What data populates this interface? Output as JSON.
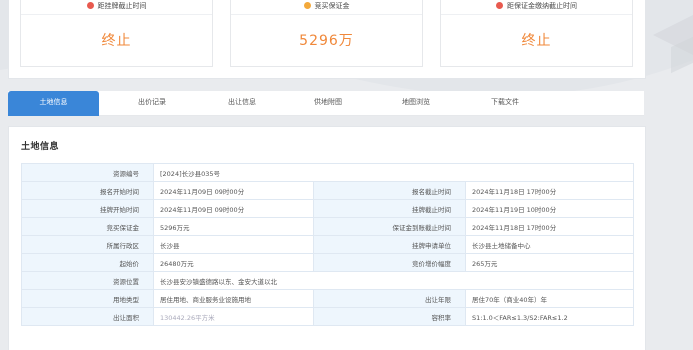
{
  "cards": [
    {
      "icon": "clock-icon",
      "icon_color": "#e85a4f",
      "label": "距挂牌截止时间",
      "value": "终止"
    },
    {
      "icon": "coin-icon",
      "icon_color": "#f3a93b",
      "label": "竞买保证金",
      "value": "5296万"
    },
    {
      "icon": "alarm-icon",
      "icon_color": "#e85a4f",
      "label": "距保证金缴纳截止时间",
      "value": "终止"
    }
  ],
  "tabs": [
    "土地信息",
    "出价记录",
    "出让信息",
    "供地附图",
    "地图浏览",
    "下载文件"
  ],
  "active_tab": "土地信息",
  "section_title": "土地信息",
  "rows": [
    {
      "full": true,
      "l1": "资源编号",
      "v1": "[2024]长沙县035号"
    },
    {
      "l1": "报名开始时间",
      "v1": "2024年11月09日 09时00分",
      "l2": "报名截止时间",
      "v2": "2024年11月18日 17时00分"
    },
    {
      "l1": "挂牌开始时间",
      "v1": "2024年11月09日 09时00分",
      "l2": "挂牌截止时间",
      "v2": "2024年11月19日 10时00分"
    },
    {
      "l1": "竞买保证金",
      "v1": "5296万元",
      "l2": "保证金到账截止时间",
      "v2": "2024年11月18日 17时00分"
    },
    {
      "l1": "所属行政区",
      "v1": "长沙县",
      "l2": "挂牌申请单位",
      "v2": "长沙县土地储备中心"
    },
    {
      "l1": "起始价",
      "v1": "26480万元",
      "l2": "竞价增价幅度",
      "v2": "265万元"
    },
    {
      "full": true,
      "l1": "资源位置",
      "v1": "长沙县安沙镇盛德路以东、金安大道以北"
    },
    {
      "l1": "用地类型",
      "v1": "居住用地、商业服务业设施用地",
      "l2": "出让年限",
      "v2": "居住70年（商业40年）年"
    },
    {
      "l1": "出让面积",
      "v1": "130442.26平方米",
      "l2": "容积率",
      "v2": "S1:1.0＜FAR≤1.3/S2:FAR≤1.2",
      "faint": true
    }
  ]
}
